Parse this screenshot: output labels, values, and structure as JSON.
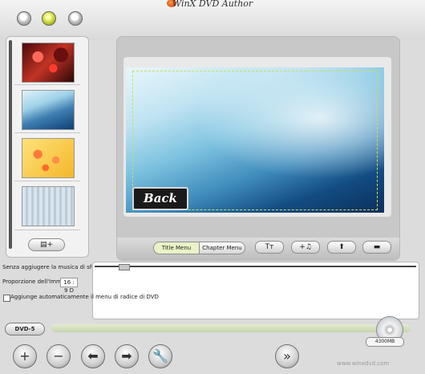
{
  "window": {
    "title": "WinX DVD Author"
  },
  "window_buttons": [
    "close",
    "minimize",
    "maximize"
  ],
  "left_panel": {
    "thumbnails": [
      {
        "name": "red-flowers-thumbnail"
      },
      {
        "name": "blue-wave-thumbnail"
      },
      {
        "name": "yellow-flowers-thumbnail"
      },
      {
        "name": "icy-forest-thumbnail"
      }
    ],
    "add_menu_icon": "▤+"
  },
  "preview": {
    "back_button_label": "Back",
    "tabs": {
      "title_menu": "Title Menu",
      "chapter_menu": "Chapter Menu"
    },
    "tools": {
      "text": "Tт",
      "music": "+♫",
      "up": "⬆",
      "line": "▬"
    }
  },
  "settings": {
    "music_label": "Senza aggiugere la musica di sfondo",
    "ratio_label": "Proporzione dell'Immagini",
    "ratio_value": "16 : 9 D",
    "auto_root_label": "Aggiunge automaticamente il menu di radice di DVD",
    "auto_root_checked": false
  },
  "bottom": {
    "dvd_type": "DVD-5",
    "capacity": "4300MB",
    "capacity_used_fraction": 0,
    "buttons": {
      "add": "+",
      "remove": "−",
      "back": "⬅",
      "forward": "➡",
      "settings": "🔧",
      "start": "»"
    },
    "website": "www.winxdvd.com"
  },
  "colors": {
    "accent": "#c6e05a",
    "tab_active_bg": "#e9f3c6"
  }
}
